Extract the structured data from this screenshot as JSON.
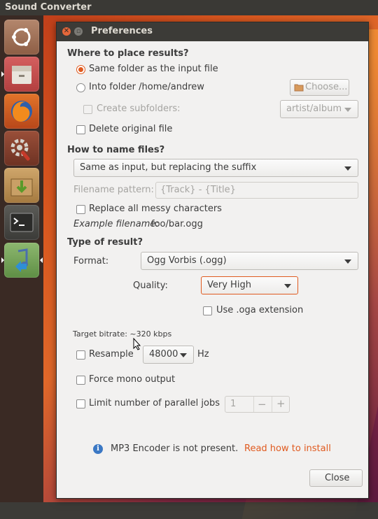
{
  "top_panel": {
    "app_title": "Sound Converter"
  },
  "launcher": {
    "items": [
      {
        "name": "ubuntu-dash"
      },
      {
        "name": "files"
      },
      {
        "name": "firefox"
      },
      {
        "name": "system-settings"
      },
      {
        "name": "software-updater"
      },
      {
        "name": "terminal"
      },
      {
        "name": "sound-converter"
      }
    ]
  },
  "dialog": {
    "title": "Preferences",
    "close_glyph": "✕",
    "minimize_glyph": "▫"
  },
  "placement": {
    "heading": "Where to place results?",
    "same_folder_label": "Same folder as the input file",
    "into_folder_label": "Into folder /home/andrew",
    "choose_button": "Choose...",
    "create_subfolders_label": "Create subfolders:",
    "subfolder_combo": "artist/album",
    "delete_original_label": "Delete original file"
  },
  "naming": {
    "heading": "How to name files?",
    "naming_combo": "Same as input, but replacing the suffix",
    "pattern_label": "Filename pattern:",
    "pattern_value": "{Track} - {Title}",
    "replace_messy_label": "Replace all messy characters",
    "example_prefix": "Example filename:",
    "example_value": "foo/bar.ogg"
  },
  "result": {
    "heading": "Type of result?",
    "format_label": "Format:",
    "format_value": "Ogg Vorbis (.ogg)",
    "quality_label": "Quality:",
    "quality_value": "Very High",
    "oga_label": "Use .oga extension",
    "target_bitrate": "Target bitrate: ~320 kbps",
    "resample_label": "Resample",
    "resample_value": "48000",
    "hz_label": "Hz",
    "force_mono_label": "Force mono output",
    "limit_jobs_label": "Limit number of parallel jobs",
    "jobs_value": "1",
    "minus": "−",
    "plus": "+"
  },
  "info": {
    "icon_glyph": "i",
    "message": "MP3 Encoder is not present.",
    "link": "Read how to install"
  },
  "footer": {
    "close_button": "Close"
  },
  "colors": {
    "accent": "#e05a1f",
    "panel": "#3c3b37",
    "dialog_bg": "#f2f1f0",
    "link": "#e05a1f",
    "info": "#3b78c4"
  }
}
